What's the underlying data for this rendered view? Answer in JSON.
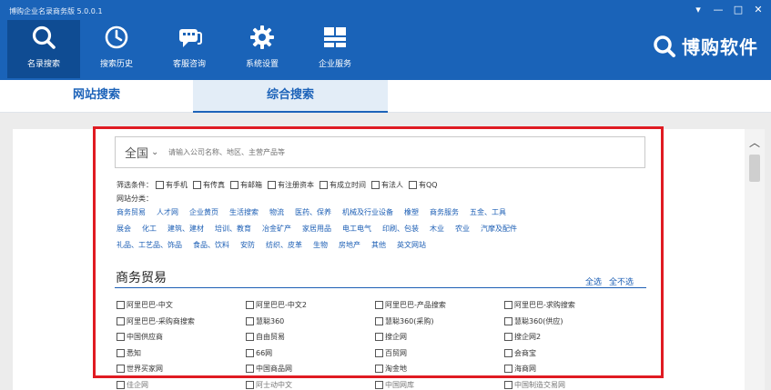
{
  "window": {
    "title": "博购企业名录商务版 5.0.0.1",
    "controls": [
      "▾",
      "—",
      "□",
      "✕"
    ]
  },
  "nav": [
    {
      "label": "名录搜索",
      "icon": "search-icon"
    },
    {
      "label": "搜索历史",
      "icon": "clock-icon"
    },
    {
      "label": "客服咨询",
      "icon": "chat-icon"
    },
    {
      "label": "系统设置",
      "icon": "gear-icon"
    },
    {
      "label": "企业服务",
      "icon": "grid-icon"
    }
  ],
  "brand": {
    "name": "博购软件"
  },
  "tabs": {
    "site": "网站搜索",
    "composite": "综合搜索"
  },
  "search": {
    "scope": "全国",
    "placeholder": "请输入公司名称、地区、主营产品等"
  },
  "filters": {
    "label": "筛选条件：",
    "options": [
      "有手机",
      "有传真",
      "有邮箱",
      "有注册资本",
      "有成立时间",
      "有法人",
      "有QQ"
    ]
  },
  "categories": {
    "label": "网站分类：",
    "rows": [
      [
        "商务贸易",
        "人才网",
        "企业黄页",
        "生活搜索",
        "物流",
        "医药、保养",
        "机械及行业设备",
        "橡塑",
        "商务服务",
        "五金、工具"
      ],
      [
        "展会",
        "化工",
        "建筑、建材",
        "培训、教育",
        "冶金矿产",
        "家居用品",
        "电工电气",
        "印刷、包装",
        "木业",
        "农业",
        "汽摩及配件"
      ],
      [
        "礼品、工艺品、饰品",
        "食品、饮料",
        "安防",
        "纺织、皮革",
        "生物",
        "房地产",
        "其他",
        "英文网站"
      ]
    ]
  },
  "section": {
    "title": "商务贸易",
    "select_all": "全选",
    "select_none": "全不选",
    "sites": [
      [
        "阿里巴巴-中文",
        "阿里巴巴-中文2",
        "阿里巴巴-产品搜索",
        "阿里巴巴-求购搜索"
      ],
      [
        "阿里巴巴-采购商搜索",
        "慧聪360",
        "慧聪360(采购)",
        "慧聪360(供应)"
      ],
      [
        "中国供应商",
        "自由贸易",
        "搜企网",
        "搜企网2"
      ],
      [
        "悉知",
        "66网",
        "百贸网",
        "会商宝"
      ],
      [
        "世界买家网",
        "中国商品网",
        "淘金地",
        "海商网"
      ],
      [
        "佳企网",
        "阿士动中文",
        "中国网库",
        "中国制造交易网"
      ]
    ]
  }
}
